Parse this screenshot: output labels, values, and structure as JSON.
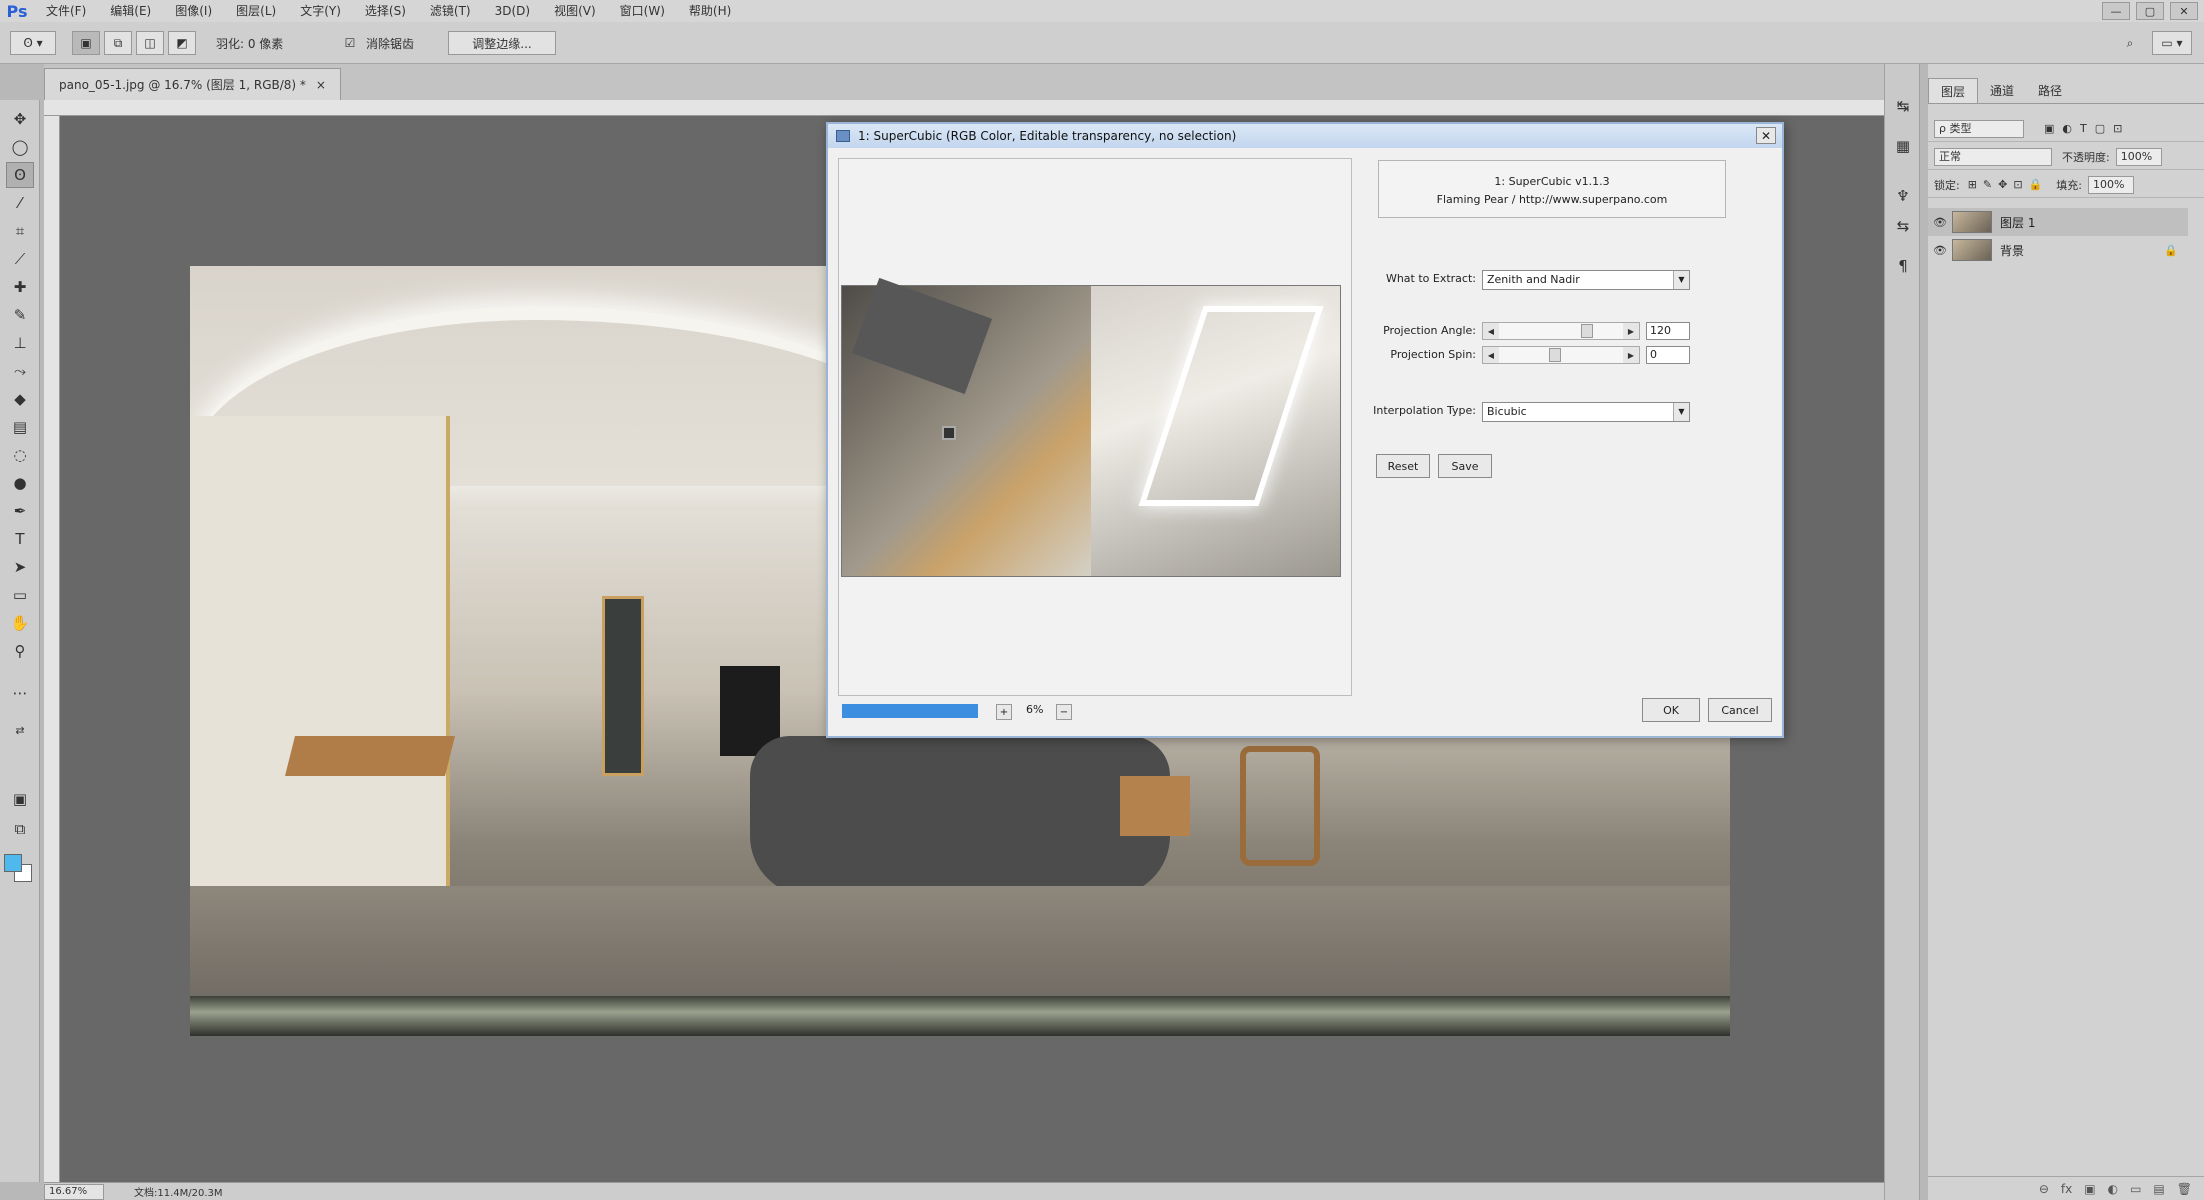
{
  "app": {
    "logo": "Ps",
    "menu": [
      "文件(F)",
      "编辑(E)",
      "图像(I)",
      "图层(L)",
      "文字(Y)",
      "选择(S)",
      "滤镜(T)",
      "3D(D)",
      "视图(V)",
      "窗口(W)",
      "帮助(H)"
    ],
    "window_controls": [
      "—",
      "▢",
      "✕"
    ]
  },
  "options": {
    "feather_label": "羽化: 0 像素",
    "antialias_label": "消除锯齿",
    "refine_edge_label": "调整边缘..."
  },
  "document": {
    "tab_title": "pano_05-1.jpg @ 16.7% (图层 1, RGB/8) *",
    "tab_close": "×"
  },
  "statusbar": {
    "zoom": "16.67%",
    "doc_info": "文档:11.4M/20.3M"
  },
  "dialog": {
    "title": "1: SuperCubic (RGB Color, Editable transparency, no selection)",
    "close": "✕",
    "info_line1": "1: SuperCubic v1.1.3",
    "info_line2": "Flaming Pear / http://www.superpano.com",
    "extract_label": "What to Extract:",
    "extract_value": "Zenith and Nadir",
    "angle_label": "Projection Angle:",
    "angle_value": "120",
    "spin_label": "Projection Spin:",
    "spin_value": "0",
    "interp_label": "Interpolation Type:",
    "interp_value": "Bicubic",
    "reset_label": "Reset",
    "save_label": "Save",
    "ok_label": "OK",
    "cancel_label": "Cancel",
    "zoom_value": "6%",
    "zoom_minus": "+",
    "zoom_plus": "−"
  },
  "panels": {
    "tabs": [
      "图层",
      "通道",
      "路径"
    ],
    "kind_filter": "ρ 类型",
    "blend_mode": "正常",
    "opacity_label": "不透明度:",
    "opacity_value": "100%",
    "lock_label": "锁定:",
    "fill_label": "填充:",
    "fill_value": "100%",
    "layers": [
      {
        "name": "图层 1",
        "selected": true
      },
      {
        "name": "背景",
        "selected": false
      }
    ],
    "footer_icons": [
      "⊖",
      "fx",
      "▣",
      "◐",
      "▭",
      "▤",
      "🗑"
    ]
  },
  "colors": {
    "foreground": "#4fb9ee",
    "background": "#ffffff",
    "progress": "#3b8ee0"
  }
}
